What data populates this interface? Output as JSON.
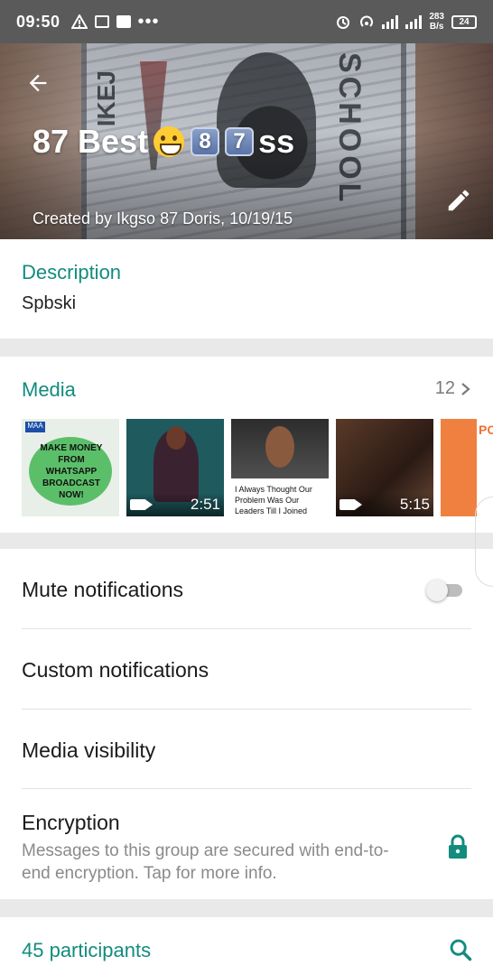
{
  "status_bar": {
    "time": "09:50",
    "left_icons": [
      "warning-icon",
      "news-icon",
      "facebook-icon",
      "more-dots-icon"
    ],
    "right_icons": [
      "alarm-icon",
      "hotspot-icon",
      "signal-icon",
      "signal-icon"
    ],
    "net_speed_value": "283",
    "net_speed_unit": "B/s",
    "battery": "24"
  },
  "header": {
    "title_prefix": "87 Best",
    "title_emoji": "grinning-face",
    "title_keycaps": [
      "8",
      "7"
    ],
    "title_suffix": "ss",
    "created_by": "Created by Ikgso 87 Doris, 10/19/15"
  },
  "description": {
    "title": "Description",
    "text": "Spbski"
  },
  "media": {
    "title": "Media",
    "count": "12",
    "items": [
      {
        "type": "image",
        "badge": "MAA",
        "text": "MAKE MONEY FROM WHATSAPP BROADCAST NOW!"
      },
      {
        "type": "video",
        "duration": "2:51"
      },
      {
        "type": "image",
        "caption": "I Always Thought Our Problem Was Our Leaders Till I Joined Politics: Yul"
      },
      {
        "type": "video",
        "duration": "5:15"
      },
      {
        "type": "image",
        "text": "PO"
      }
    ]
  },
  "settings": {
    "mute": {
      "label": "Mute notifications",
      "enabled": false
    },
    "custom": {
      "label": "Custom notifications"
    },
    "visibility": {
      "label": "Media visibility"
    },
    "encryption": {
      "label": "Encryption",
      "subtitle": "Messages to this group are secured with end-to-end encryption. Tap for more info."
    }
  },
  "participants": {
    "title": "45 participants"
  },
  "colors": {
    "accent": "#128c7e",
    "status_bar": "#5a5a5a",
    "muted_text": "#8a8a8a"
  }
}
